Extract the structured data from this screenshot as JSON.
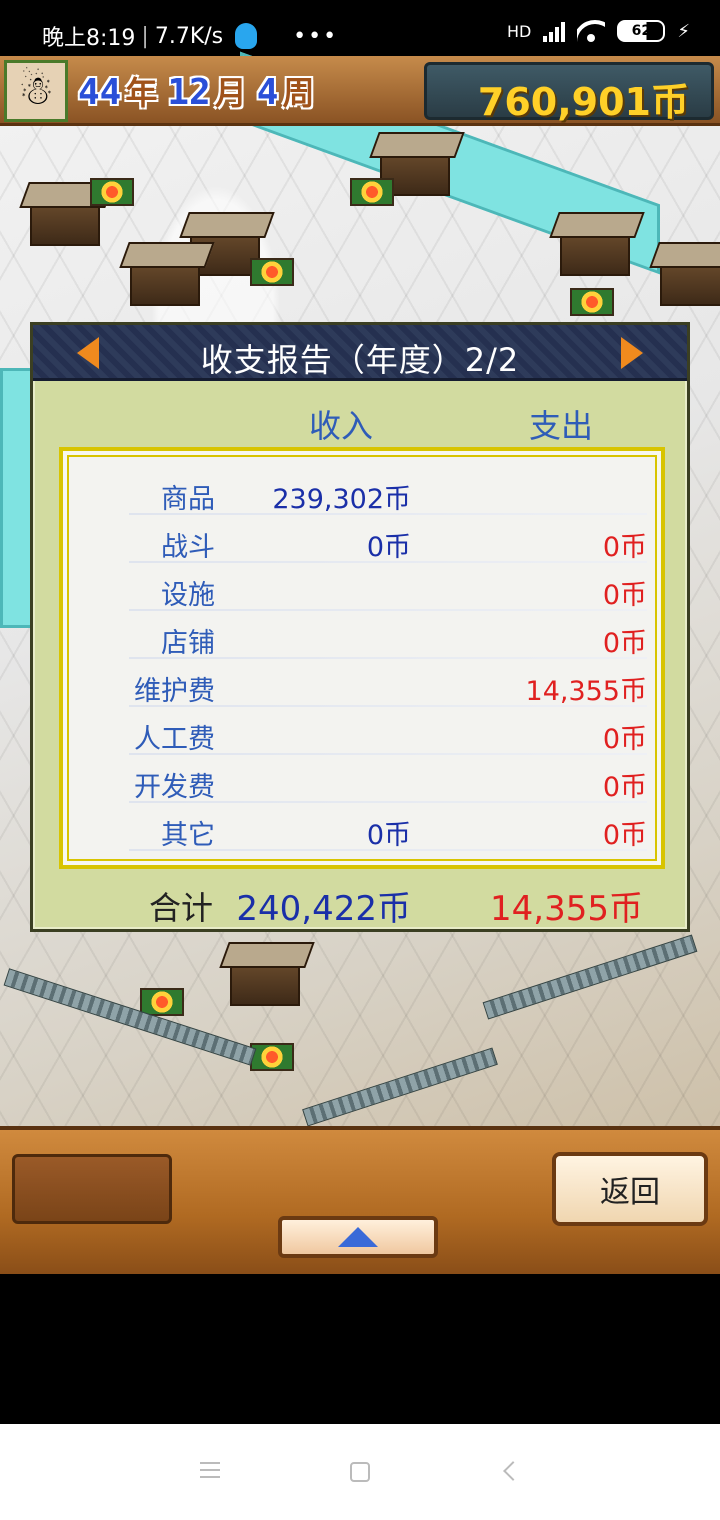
{
  "status_bar": {
    "time": "晚上8:19",
    "speed": "7.7K/s",
    "more": "•••",
    "battery": "62",
    "network": "HD"
  },
  "hud": {
    "year": "44",
    "year_unit": "年",
    "month": "12",
    "month_unit": "月",
    "week": "4",
    "week_unit": "周",
    "money": "760,901币",
    "avatar_icon": "snowman-icon"
  },
  "report": {
    "title": "收支报告（年度）2/2",
    "income_header": "收入",
    "expense_header": "支出",
    "rows": [
      {
        "label": "商品",
        "income": "239,302币",
        "expense": ""
      },
      {
        "label": "战斗",
        "income": "0币",
        "expense": "0币"
      },
      {
        "label": "设施",
        "income": "",
        "expense": "0币"
      },
      {
        "label": "店铺",
        "income": "",
        "expense": "0币"
      },
      {
        "label": "维护费",
        "income": "",
        "expense": "14,355币"
      },
      {
        "label": "人工费",
        "income": "",
        "expense": "0币"
      },
      {
        "label": "开发费",
        "income": "",
        "expense": "0币"
      },
      {
        "label": "其它",
        "income": "0币",
        "expense": "0币"
      }
    ],
    "total_label": "合计",
    "total_income": "240,422币",
    "total_expense": "14,355币",
    "colors": {
      "income": "#1a2fa8",
      "expense": "#e02020",
      "label": "#2f5cb8"
    }
  },
  "bottom": {
    "back_label": "返回"
  }
}
